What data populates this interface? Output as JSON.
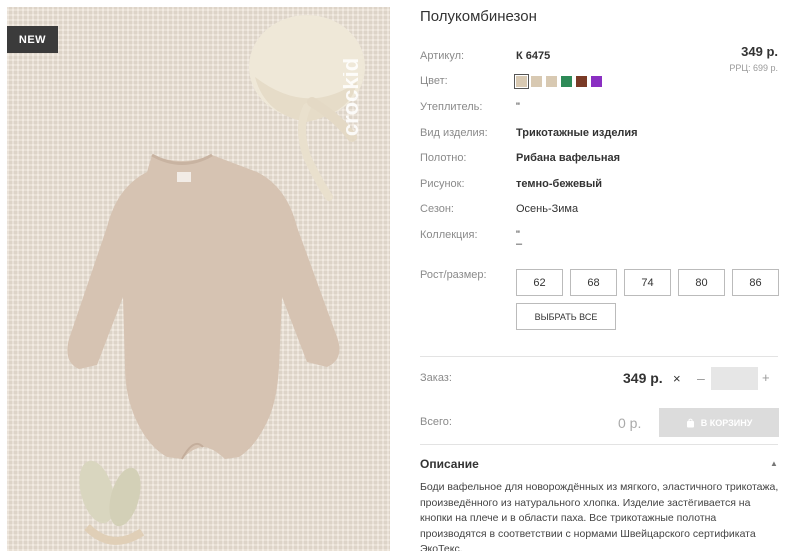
{
  "photo": {
    "badge": "NEW",
    "brand_watermark": "crockid"
  },
  "product": {
    "title": "Полукомбинезон",
    "price": "349 р.",
    "rrp": "РРЦ: 699 р.",
    "attributes": {
      "article": {
        "label": "Артикул:",
        "value": "К 6475"
      },
      "color": {
        "label": "Цвет:"
      },
      "insulation": {
        "label": "Утеплитель:",
        "value": "\""
      },
      "type": {
        "label": "Вид изделия:",
        "value": "Трикотажные изделия"
      },
      "fabric": {
        "label": "Полотно:",
        "value": "Рибана вафельная"
      },
      "pattern": {
        "label": "Рисунок:",
        "value": "темно-бежевый"
      },
      "season": {
        "label": "Сезон:",
        "value": "Осень-Зима"
      },
      "collection": {
        "label": "Коллекция:",
        "value": "\"",
        "value2": "–"
      }
    },
    "swatches": [
      "#d8c9b2",
      "#d8c9b2",
      "#d8c9b2",
      "#2e8a57",
      "#7a3a26",
      "#8a2fc2"
    ],
    "sizes_label": "Рост/размер:",
    "sizes": [
      "62",
      "68",
      "74",
      "80",
      "86"
    ],
    "select_all": "ВЫБРАТЬ ВСЕ"
  },
  "order": {
    "label": "Заказ:",
    "price": "349 р.",
    "times": "×",
    "minus": "–",
    "plus": "+",
    "quantity": ""
  },
  "total": {
    "label": "Всего:",
    "value": "0 р.",
    "cart_button": "В КОРЗИНУ"
  },
  "description": {
    "title": "Описание",
    "text": "Боди вафельное для новорождённых из мягкого, эластичного трикотажа, произведённого из натурального хлопка. Изделие застёгивается на кнопки на плече и в области паха. Все трикотажные полотна производятся в соответствии с нормами Швейцарского сертификата ЭкоТекс."
  }
}
